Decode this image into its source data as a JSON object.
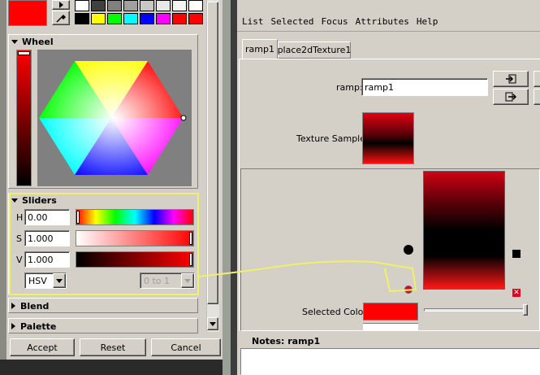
{
  "color_chooser": {
    "current_color": "#ff0000",
    "swatch_row1": [
      "#ffffff",
      "#404040",
      "#808080",
      "#a0a0a0",
      "#c8c8c8",
      "#e8e8e8",
      "#f4f4f4",
      "#ffffff"
    ],
    "swatch_row2": [
      "#000000",
      "#ffff00",
      "#00ff00",
      "#00ffff",
      "#0000ff",
      "#ff00ff",
      "#ff0000",
      "#ff0000"
    ],
    "wheel": {
      "title": "Wheel"
    },
    "sliders": {
      "title": "Sliders",
      "h_label": "H",
      "h_value": "0.00",
      "s_label": "S",
      "s_value": "1.000",
      "v_label": "V",
      "v_value": "1.000",
      "mode": "HSV",
      "range": "0 to 1"
    },
    "blend": {
      "title": "Blend"
    },
    "palette": {
      "title": "Palette"
    },
    "buttons": {
      "accept": "Accept",
      "reset": "Reset",
      "cancel": "Cancel"
    }
  },
  "attribute_editor": {
    "menu": [
      "List",
      "Selected",
      "Focus",
      "Attributes",
      "Help"
    ],
    "tabs": [
      "ramp1",
      "place2dTexture1"
    ],
    "ramp_label": "ramp:",
    "ramp_value": "ramp1",
    "texture_sample_label": "Texture Sample",
    "selected_color_label": "Selected Color",
    "selected_color": "#ff0000",
    "notes_title": "Notes: ramp1"
  },
  "annotation_color": "#f0f06a"
}
